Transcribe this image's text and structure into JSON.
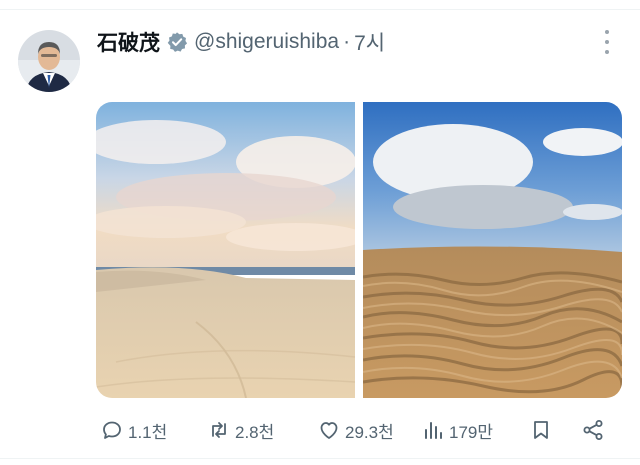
{
  "post": {
    "author_name": "石破茂",
    "handle": "@shigeruishiba",
    "separator": "·",
    "time": "7시",
    "verified": true
  },
  "media": [
    {
      "description_icon": "dunes-sunrise-photo"
    },
    {
      "description_icon": "dunes-ripples-photo"
    }
  ],
  "actions": {
    "reply_count": "1.1천",
    "repost_count": "2.8천",
    "like_count": "29.3천",
    "views_count": "179만"
  },
  "colors": {
    "text_secondary": "#536471",
    "verified_badge": "#829aab",
    "divider": "#eff3f4"
  }
}
